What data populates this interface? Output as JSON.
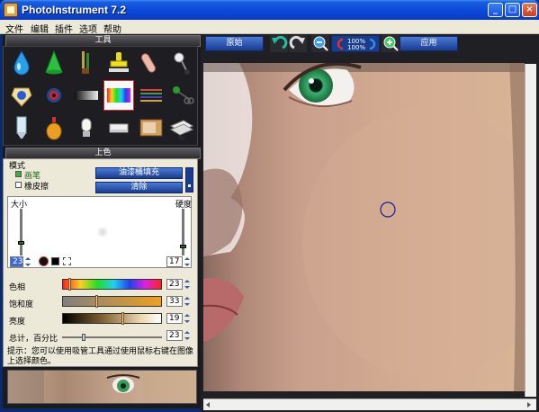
{
  "window": {
    "title": "PhotoInstrument 7.2"
  },
  "menu": {
    "items": [
      "文件",
      "编辑",
      "插件",
      "选项",
      "帮助"
    ]
  },
  "tools_panel": {
    "title": "工具"
  },
  "color_panel": {
    "title": "上色",
    "mode_label": "模式",
    "brush_label": "画笔",
    "eraser_label": "橡皮擦",
    "flood_fill_button": "油漆桶填充",
    "clear_button": "清除",
    "size_label": "大小",
    "hardness_label": "硬度",
    "size_value": "23",
    "hardness_value": "17",
    "hue_label": "色相",
    "hue_value": "23",
    "saturation_label": "饱和度",
    "saturation_value": "33",
    "brightness_label": "亮度",
    "brightness_value": "19",
    "total_percent_label": "总计，百分比",
    "total_percent_value": "23",
    "hint": "提示：您可以使用吸管工具通过使用鼠标右键在图像上选择颜色。"
  },
  "toolbar": {
    "original_button": "原始",
    "zoom_top": "100%",
    "zoom_bottom": "100%",
    "apply_button": "应用"
  },
  "colors": {
    "title_bar": "#0a4ad8",
    "panel_dark": "#1b1b1f",
    "button_blue": "#1a3c8c",
    "brush_circle": "#1a1a9a"
  }
}
